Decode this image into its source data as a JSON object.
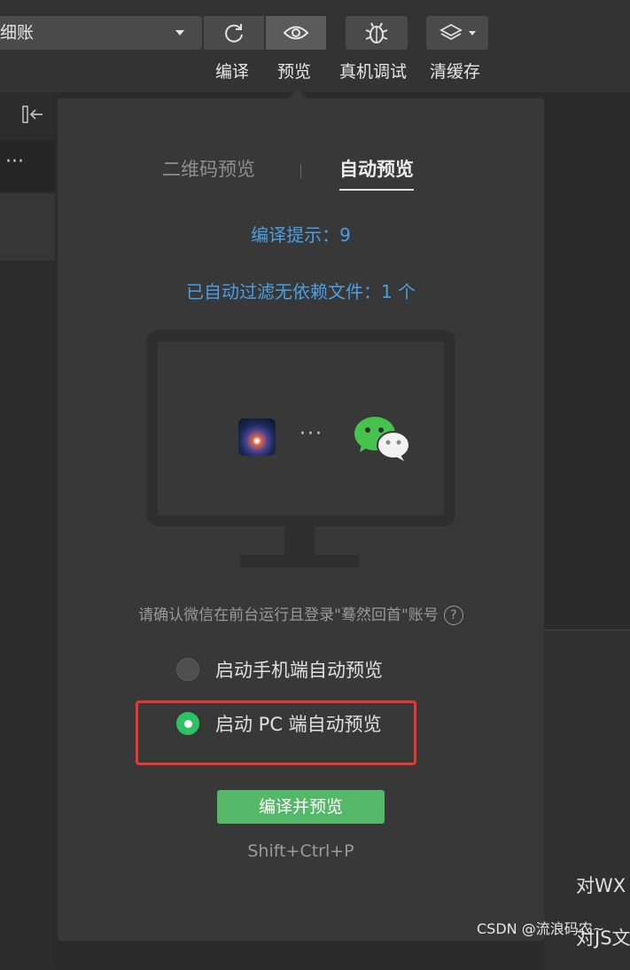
{
  "toolbar": {
    "mode_select_value": "细账",
    "buttons": [
      {
        "label": "编译",
        "icon": "refresh-icon"
      },
      {
        "label": "预览",
        "icon": "eye-icon"
      },
      {
        "label": "真机调试",
        "icon": "bug-icon"
      },
      {
        "label": "清缓存",
        "icon": "layers-icon"
      }
    ]
  },
  "sidebar": {
    "collapse_icon": "collapse-left-icon",
    "more": "···"
  },
  "background": {
    "text_wxml": "对WX",
    "text_js": "对JS文"
  },
  "preview_panel": {
    "tabs": [
      {
        "label": "二维码预览",
        "active": false
      },
      {
        "label": "自动预览",
        "active": true
      }
    ],
    "compile_hint": "编译提示：9",
    "filter_notice": "已自动过滤无依赖文件：1 个",
    "illustration": {
      "app_icon": "app-avatar-icon",
      "separator": "···",
      "wechat_icon": "wechat-icon"
    },
    "confirm_text": "请确认微信在前台运行且登录\"蓦然回首\"账号",
    "help_icon": "?",
    "options": [
      {
        "label": "启动手机端自动预览",
        "selected": false
      },
      {
        "label": "启动 PC 端自动预览",
        "selected": true
      }
    ],
    "primary_button": "编译并预览",
    "shortcut": "Shift+Ctrl+P"
  },
  "colors": {
    "accent_green": "#55b868",
    "link_blue": "#4a9fe3",
    "highlight_red": "#e53a32"
  },
  "watermark": "CSDN @流浪码农~"
}
